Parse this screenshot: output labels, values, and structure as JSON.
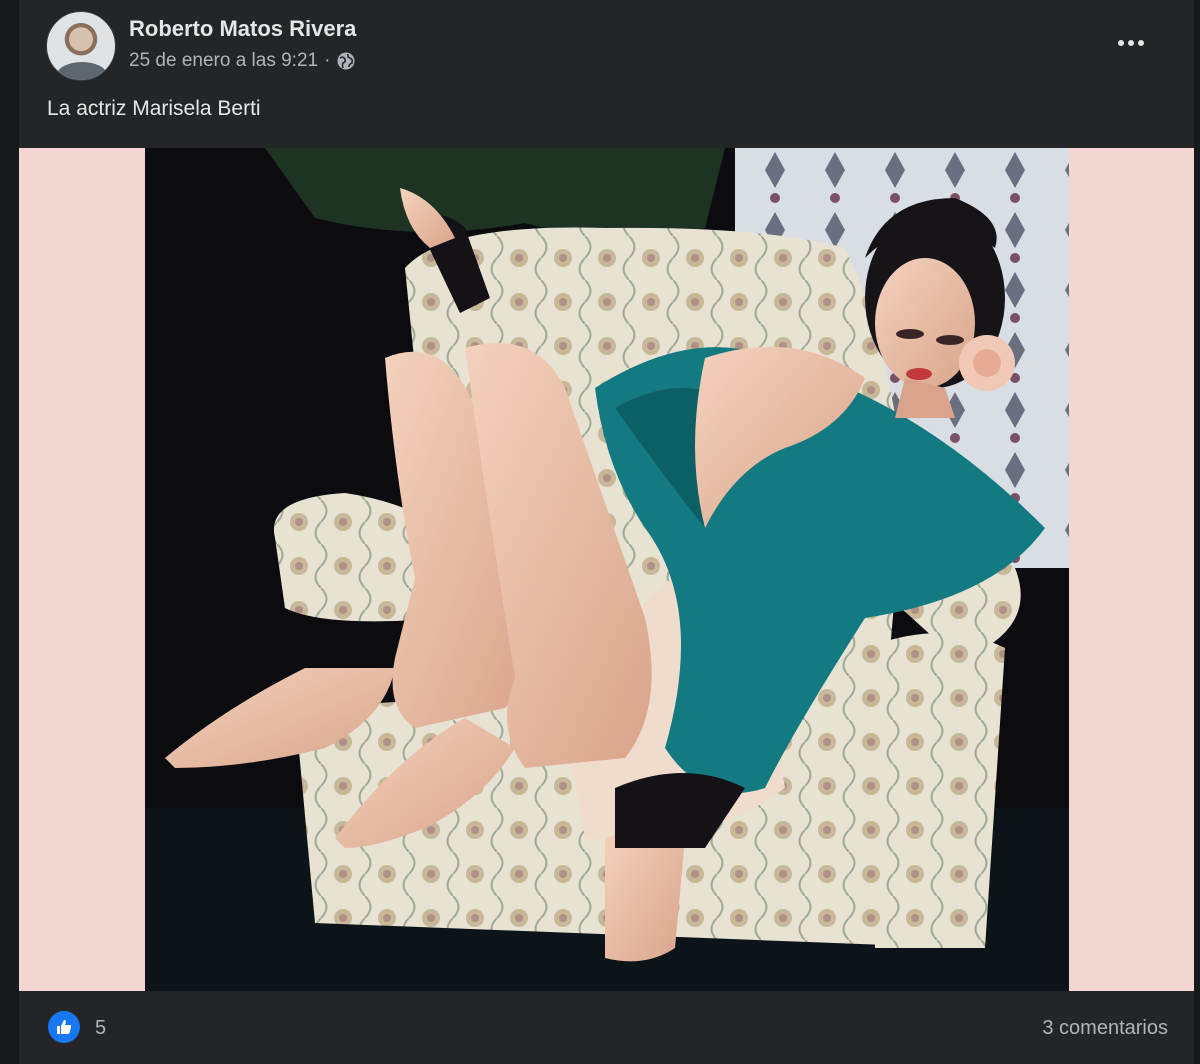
{
  "post": {
    "author": "Roberto Matos Rivera",
    "timestamp": "25 de enero a las 9:21",
    "separator": "·",
    "audience_icon": "globe-icon",
    "more_icon": "more-horizontal-icon",
    "caption": "La actriz Marisela Berti"
  },
  "media": {
    "background_color": "#f2d6d2"
  },
  "footer": {
    "reaction_icon": "like-icon",
    "reaction_count": "5",
    "comments": "3 comentarios"
  },
  "colors": {
    "card": "#242526",
    "page": "#18191a",
    "text_primary": "#e4e6eb",
    "text_secondary": "#b0b3b8",
    "like_blue": "#1877f2"
  }
}
